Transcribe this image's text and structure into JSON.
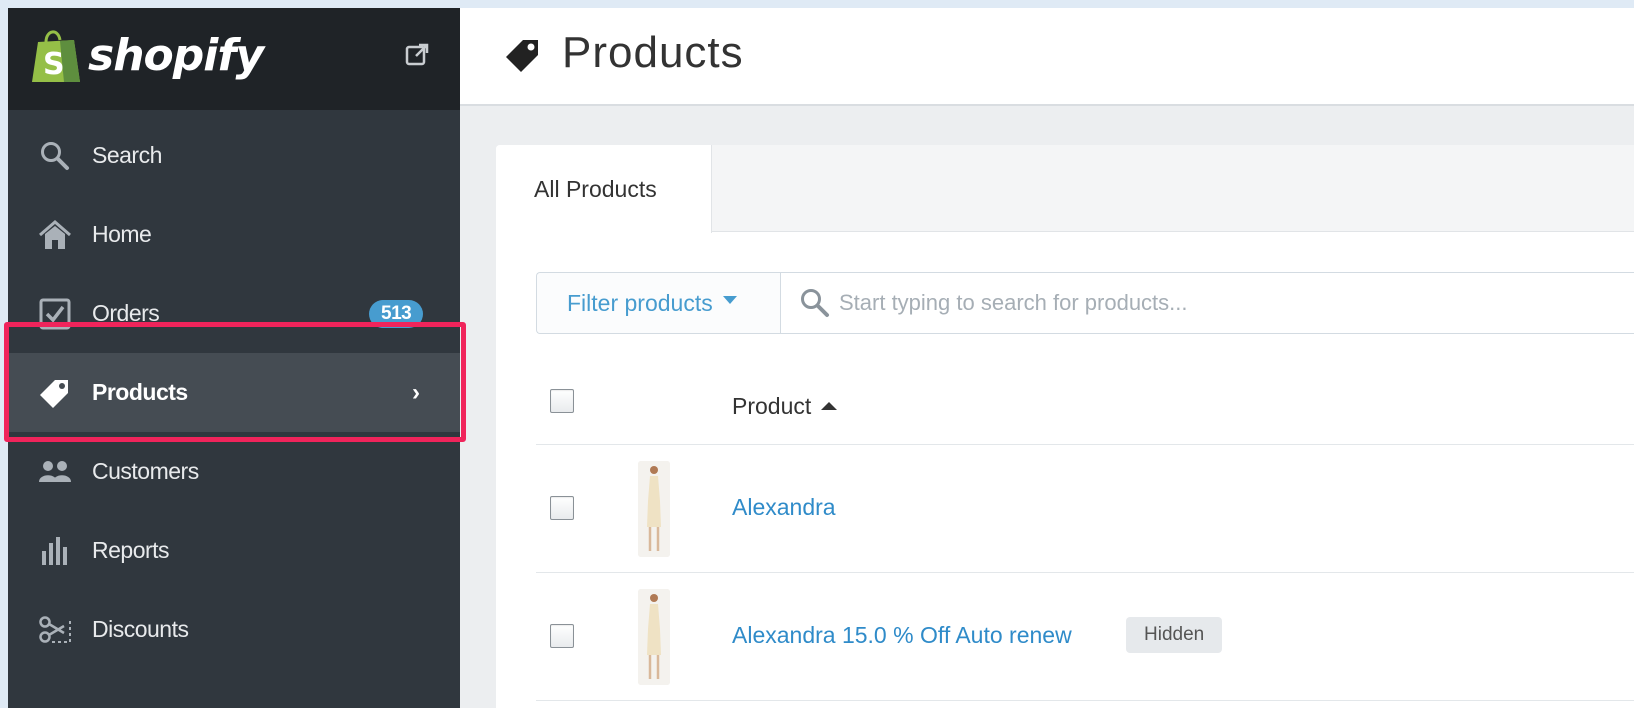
{
  "sidebar": {
    "brand": "shopify",
    "brand_logo_letter": "S",
    "items": [
      {
        "label": "Search",
        "icon": "search-icon"
      },
      {
        "label": "Home",
        "icon": "home-icon"
      },
      {
        "label": "Orders",
        "icon": "orders-check-icon",
        "badge": "513"
      },
      {
        "label": "Products",
        "icon": "tag-icon",
        "active": true
      },
      {
        "label": "Customers",
        "icon": "customers-icon"
      },
      {
        "label": "Reports",
        "icon": "bar-chart-icon"
      },
      {
        "label": "Discounts",
        "icon": "scissors-icon"
      }
    ]
  },
  "header": {
    "title": "Products",
    "icon": "tag-icon"
  },
  "tabs": [
    {
      "label": "All Products",
      "active": true
    }
  ],
  "filter": {
    "button_label": "Filter products",
    "search_placeholder": "Start typing to search for products..."
  },
  "table": {
    "column_product": "Product",
    "rows": [
      {
        "name": "Alexandra",
        "badge": ""
      },
      {
        "name": "Alexandra 15.0 % Off Auto renew",
        "badge": "Hidden"
      }
    ]
  },
  "colors": {
    "sidebar_bg": "#30373e",
    "brand_bg": "#1f2327",
    "active_bg": "#454c53",
    "accent_blue": "#479ccf",
    "link_blue": "#2f8bc9",
    "highlight": "#f0245b",
    "shopify_green": "#95bf47"
  }
}
